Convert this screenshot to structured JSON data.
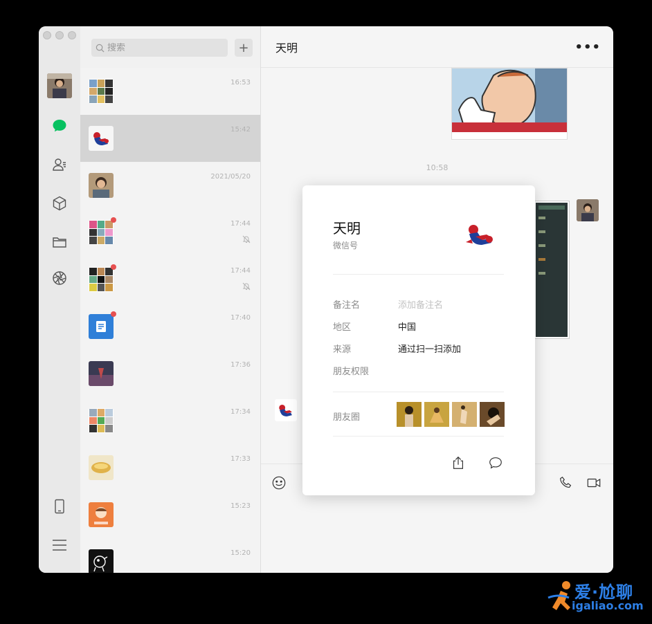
{
  "search": {
    "placeholder": "搜索"
  },
  "list": {
    "add_label": "+",
    "items": [
      {
        "time": "16:53",
        "avatar": "group-grid-icon",
        "badge": false,
        "muted": false
      },
      {
        "time": "15:42",
        "avatar": "spiderman-avatar",
        "badge": false,
        "muted": false,
        "selected": true
      },
      {
        "time": "2021/05/20",
        "avatar": "person-photo-avatar",
        "badge": false,
        "muted": false
      },
      {
        "time": "17:44",
        "avatar": "group-grid-icon",
        "badge": true,
        "muted": true
      },
      {
        "time": "17:44",
        "avatar": "group-grid-icon",
        "badge": true,
        "muted": true
      },
      {
        "time": "17:40",
        "avatar": "doc-icon",
        "badge": true,
        "muted": false
      },
      {
        "time": "17:36",
        "avatar": "photo-avatar",
        "badge": false,
        "muted": false
      },
      {
        "time": "17:34",
        "avatar": "group-grid-icon",
        "badge": false,
        "muted": false
      },
      {
        "time": "17:33",
        "avatar": "food-avatar",
        "badge": false,
        "muted": false
      },
      {
        "time": "15:23",
        "avatar": "cartoon-avatar",
        "badge": false,
        "muted": false
      },
      {
        "time": "15:20",
        "avatar": "sketch-avatar",
        "badge": false,
        "muted": false
      }
    ]
  },
  "chat": {
    "title": "天明",
    "more_label": "•••",
    "timestamp": "10:58"
  },
  "profile": {
    "name": "天明",
    "wechat_id_label": "微信号",
    "remark_label": "备注名",
    "remark_placeholder": "添加备注名",
    "region_label": "地区",
    "region_value": "中国",
    "source_label": "来源",
    "source_value": "通过扫一扫添加",
    "permission_label": "朋友权限",
    "moments_label": "朋友圈"
  },
  "watermark": {
    "brand": "爱·尬聊",
    "url": "igaliao.com"
  },
  "colors": {
    "accent_green": "#07c160",
    "badge_red": "#e65050",
    "brand_blue": "#2d7fe6"
  }
}
